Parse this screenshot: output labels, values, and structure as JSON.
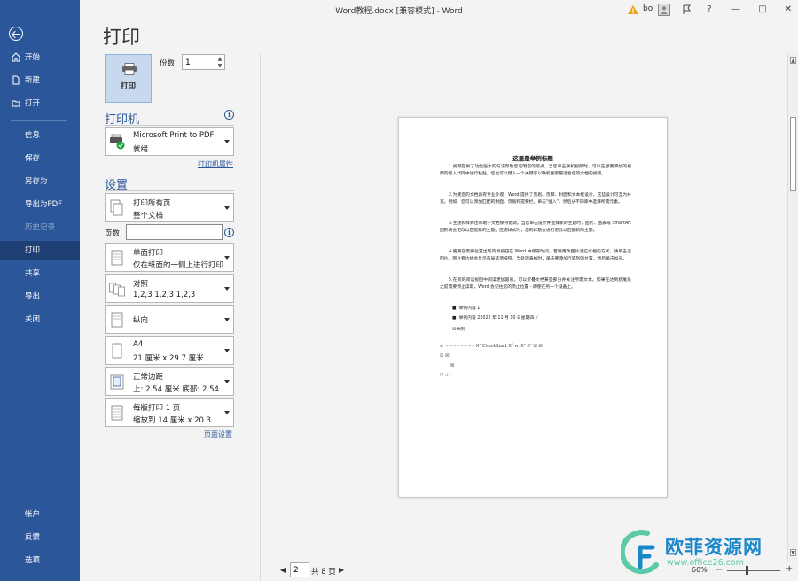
{
  "window": {
    "title": "Word教程.docx [兼容模式] - Word",
    "user": "bo",
    "icons": [
      "warning-icon",
      "avatar-icon",
      "feedback-icon",
      "help-icon",
      "minimize-icon",
      "maximize-icon",
      "close-icon"
    ]
  },
  "sidebar": {
    "items": [
      {
        "label": "开始",
        "icon": "home-icon"
      },
      {
        "label": "新建",
        "icon": "new-document-icon"
      },
      {
        "label": "打开",
        "icon": "folder-open-icon"
      },
      {
        "label": "信息"
      },
      {
        "label": "保存"
      },
      {
        "label": "另存为"
      },
      {
        "label": "导出为PDF"
      },
      {
        "label": "历史记录"
      },
      {
        "label": "打印"
      },
      {
        "label": "共享"
      },
      {
        "label": "导出"
      },
      {
        "label": "关闭"
      }
    ],
    "bottom_items": [
      {
        "label": "帐户"
      },
      {
        "label": "反馈"
      },
      {
        "label": "选项"
      }
    ]
  },
  "print_pane": {
    "heading": "打印",
    "print_button_label": "打印",
    "copies_label": "份数:",
    "copies_value": "1",
    "printer_section": "打印机",
    "printer_name": "Microsoft Print to PDF",
    "printer_status": "就绪",
    "printer_properties_link": "打印机属性",
    "settings_section": "设置",
    "settings": [
      {
        "line1": "打印所有页",
        "line2": "整个文档"
      },
      {
        "line1": "单面打印",
        "line2": "仅在纸面的一侧上进行打印"
      },
      {
        "line1": "对照",
        "line2": "1,2,3    1,2,3    1,2,3"
      },
      {
        "line1": "纵向",
        "line2": ""
      },
      {
        "line1": "A4",
        "line2": "21 厘米 x 29.7 厘米"
      },
      {
        "line1": "正常边距",
        "line2": "上: 2.54 厘米 底部: 2.54..."
      },
      {
        "line1": "每版打印 1 页",
        "line2": "缩放到 14 厘米 x 20.3..."
      }
    ],
    "pages_label": "页数:",
    "pages_value": "",
    "page_setup_link": "页面设置"
  },
  "preview": {
    "title": "这里是举例标题",
    "paragraphs": [
      "1.视频提供了功能强大的方法帮助您证明您的观点。当您单击联机视频时，可以在想要添加的视频的嵌入代码中进行粘贴。您也可以键入一个关键字以联机搜索最适合您的文档的视频。",
      "2.为使您的文档具有专业外观，Word 提供了页眉、页脚、封面和文本框设计，这些设计可互为补充。例如，您可以添加匹配的封面、页眉和提要栏。单击\"插入\"，然后从不同库中选择所需元素。",
      "3.主题和样式也有助于文档保持协调。当您单击设计并选择新的主题时，图片、图表或 SmartArt 图形将会更改以匹配新的主题。应用样式时，您的标题会进行更改以匹配新的主题。",
      "4.使用在需要位置出现的新按钮在 Word 中保存时间。若要更改图片适应文档的方式，请单击该图片，图片旁边将会显示布局选项按钮。当处理表格时，单击要添加行或列的位置，然后单击加号。",
      "5.在新的阅读视图中阅读更加容易。可以折叠文档某些部分并关注所需文本。如果在达到结尾处之前需要停止读取，Word 会记住您的停止位置 - 即使在另一个设备上。"
    ],
    "bullets": [
      "举例内容 1",
      "举例内容 22022 年 11 月 10 日星期四 √"
    ],
    "checkbox_label": "举例",
    "symbols_line1": "≡   ~~~~~~~~   X²   CheckBox1         Xˇ      н.      X²  X²     ☑  ☒",
    "symbols_line2": "☑  ☒",
    "symbols_line3": "☒",
    "symbols_line4": "☐  √  -"
  },
  "bottom_bar": {
    "page_number": "2",
    "total_pages": "共 8 页",
    "zoom": "60%"
  },
  "watermark": {
    "text": "欧菲资源网",
    "url": "www.office26.com"
  },
  "colors": {
    "sidebar": "#2b579a",
    "sidebar_active": "#1e3f73",
    "accent": "#2b579a",
    "watermark_green": "#5cc9a7",
    "watermark_blue": "#1a87c9"
  }
}
